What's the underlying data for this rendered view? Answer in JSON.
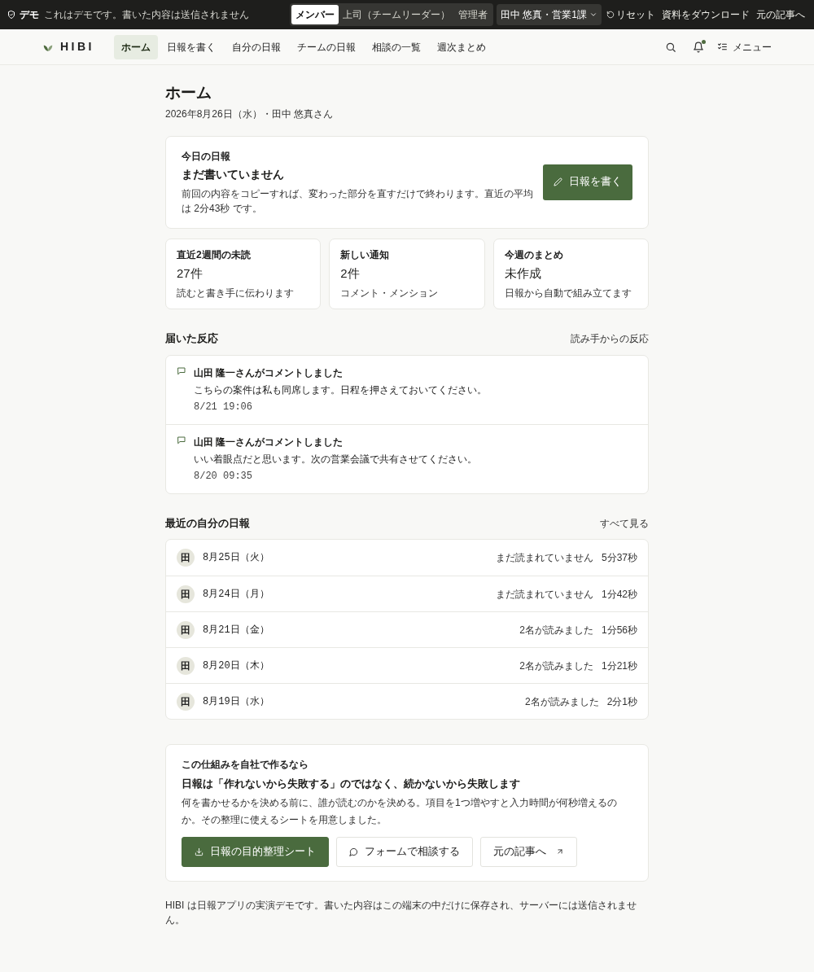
{
  "demo_bar": {
    "badge": "デモ",
    "notice": "これはデモです。書いた内容は送信されません",
    "roles": [
      {
        "label": "メンバー",
        "selected": true
      },
      {
        "label": "上司（チームリーダー）",
        "selected": false
      },
      {
        "label": "管理者",
        "selected": false
      }
    ],
    "user_select": "田中 悠真・営業1課",
    "links": [
      {
        "label": "リセット",
        "kind": "reset"
      },
      {
        "label": "資料をダウンロード",
        "kind": "plain"
      },
      {
        "label": "元の記事へ",
        "kind": "plain"
      }
    ]
  },
  "nav": {
    "logo": "HIBI",
    "items": [
      {
        "label": "ホーム",
        "selected": true
      },
      {
        "label": "日報を書く",
        "selected": false
      },
      {
        "label": "自分の日報",
        "selected": false
      },
      {
        "label": "チームの日報",
        "selected": false
      },
      {
        "label": "相談の一覧",
        "selected": false
      },
      {
        "label": "週次まとめ",
        "selected": false
      }
    ],
    "notification_dot": true,
    "menu": "メニュー"
  },
  "page": {
    "title": "ホーム",
    "subtitle": "2026年8月26日（水）・田中 悠真さん"
  },
  "today": {
    "label": "今日の日報",
    "status": "まだ書いていません",
    "hint": "前回の内容をコピーすれば、変わった部分を直すだけで終わります。直近の平均は 2分43秒 です。",
    "button": "日報を書く"
  },
  "stats": [
    {
      "label": "直近2週間の未読",
      "value": "27件",
      "note": "読むと書き手に伝わります"
    },
    {
      "label": "新しい通知",
      "value": "2件",
      "note": "コメント・メンション"
    },
    {
      "label": "今週のまとめ",
      "value": "未作成",
      "note": "日報から自動で組み立てます"
    }
  ],
  "reactions": {
    "title": "届いた反応",
    "aside": "読み手からの反応",
    "items": [
      {
        "title": "山田 隆一さんがコメントしました",
        "body": "こちらの案件は私も同席します。日程を押さえておいてください。",
        "time": "8/21 19:06"
      },
      {
        "title": "山田 隆一さんがコメントしました",
        "body": "いい着眼点だと思います。次の営業会議で共有させてください。",
        "time": "8/20 09:35"
      }
    ]
  },
  "recent": {
    "title": "最近の自分の日報",
    "link": "すべて見る",
    "rows": [
      {
        "avatar": "田",
        "date": "8月25日（火）",
        "reads": "まだ読まれていません",
        "duration": "5分37秒"
      },
      {
        "avatar": "田",
        "date": "8月24日（月）",
        "reads": "まだ読まれていません",
        "duration": "1分42秒"
      },
      {
        "avatar": "田",
        "date": "8月21日（金）",
        "reads": "2名が読みました",
        "duration": "1分56秒"
      },
      {
        "avatar": "田",
        "date": "8月20日（木）",
        "reads": "2名が読みました",
        "duration": "1分21秒"
      },
      {
        "avatar": "田",
        "date": "8月19日（水）",
        "reads": "2名が読みました",
        "duration": "2分1秒"
      }
    ]
  },
  "promo": {
    "label": "この仕組みを自社で作るなら",
    "title": "日報は「作れないから失敗する」のではなく、続かないから失敗します",
    "body": "何を書かせるかを決める前に、誰が読むのかを決める。項目を1つ増やすと入力時間が何秒増えるのか。その整理に使えるシートを用意しました。",
    "buttons": [
      {
        "label": "日報の目的整理シート",
        "kind": "download"
      },
      {
        "label": "フォームで相談する",
        "kind": "chat"
      },
      {
        "label": "元の記事へ",
        "kind": "external"
      }
    ]
  },
  "footer": "HIBI は日報アプリの実演デモです。書いた内容はこの端末の中だけに保存され、サーバーには送信されません。"
}
